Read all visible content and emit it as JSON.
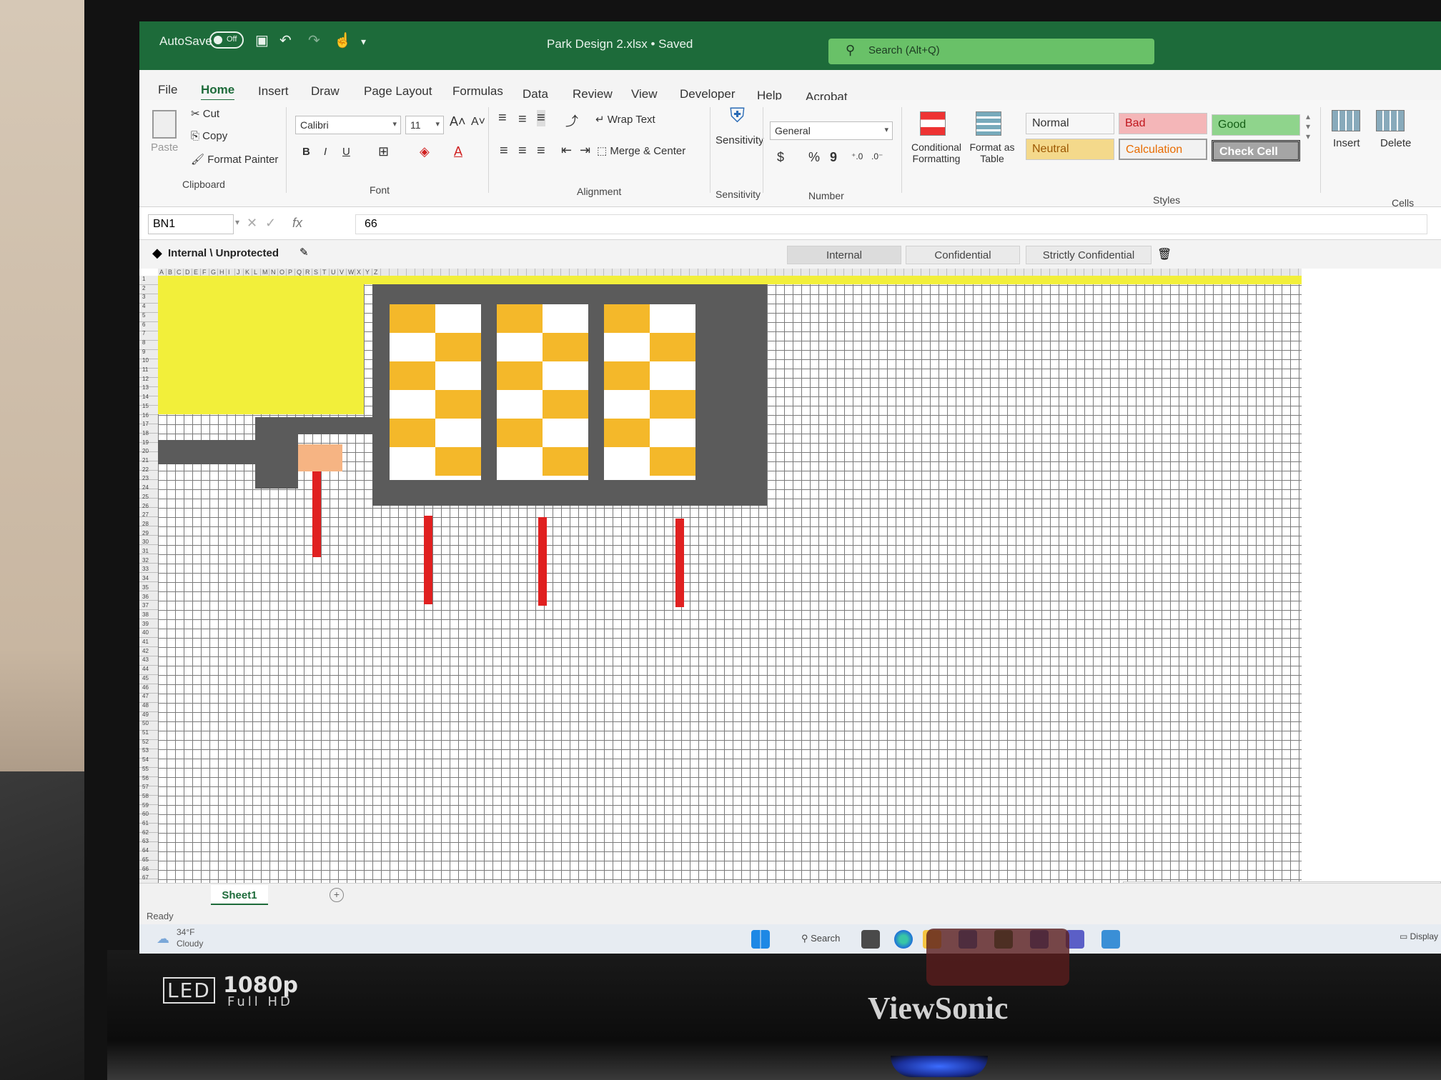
{
  "titlebar": {
    "autosave": "AutoSave",
    "autosave_state": "Off",
    "document": "Park Design 2.xlsx • Saved",
    "search": "Search (Alt+Q)"
  },
  "tabs": [
    "File",
    "Home",
    "Insert",
    "Draw",
    "Page Layout",
    "Formulas",
    "Data",
    "Review",
    "View",
    "Developer",
    "Help",
    "Acrobat"
  ],
  "ribbon": {
    "clipboard": {
      "paste": "Paste",
      "cut": "Cut",
      "copy": "Copy",
      "format_painter": "Format Painter",
      "label": "Clipboard"
    },
    "font": {
      "name": "Calibri",
      "size": "11",
      "bold": "B",
      "italic": "I",
      "underline": "U",
      "label": "Font"
    },
    "alignment": {
      "wrap_text": "Wrap Text",
      "merge_center": "Merge & Center",
      "label": "Alignment"
    },
    "sensitivity": {
      "button": "Sensitivity",
      "label": "Sensitivity"
    },
    "number": {
      "format": "General",
      "currency": "$",
      "percent": "%",
      "comma": "9",
      "label": "Number"
    },
    "styles": {
      "conditional": "Conditional Formatting",
      "format_table": "Format as Table",
      "label": "Styles",
      "cells": [
        {
          "name": "Normal",
          "bg": "#ffffff",
          "fg": "#000000"
        },
        {
          "name": "Bad",
          "bg": "#ffc7ce",
          "fg": "#9c0006"
        },
        {
          "name": "Good",
          "bg": "#c6efce",
          "fg": "#006100"
        },
        {
          "name": "Neutral",
          "bg": "#ffeb9c",
          "fg": "#9c5700"
        },
        {
          "name": "Calculation",
          "bg": "#f2f2f2",
          "fg": "#fa7d00"
        },
        {
          "name": "Check Cell",
          "bg": "#a5a5a5",
          "fg": "#ffffff"
        }
      ]
    },
    "cells": {
      "insert": "Insert",
      "delete": "Delete",
      "label": "Cells"
    }
  },
  "formula_bar": {
    "name_box": "BN1",
    "fx": "fx",
    "value": "66"
  },
  "sensitivity_bar": {
    "label": "Internal \\ Unprotected",
    "options": [
      "Internal",
      "Confidential",
      "Strictly Confidential"
    ]
  },
  "row_numbers": [
    "1",
    "2",
    "3",
    "4",
    "5",
    "6",
    "7",
    "8",
    "9",
    "10",
    "11",
    "12",
    "13",
    "14",
    "15",
    "16",
    "17",
    "18",
    "19",
    "20",
    "21",
    "22",
    "23",
    "24",
    "25",
    "26",
    "27",
    "28",
    "29",
    "30",
    "31",
    "32",
    "33",
    "34",
    "35",
    "36",
    "37",
    "38",
    "39",
    "40",
    "41",
    "42",
    "43",
    "44",
    "45",
    "46",
    "47",
    "48",
    "49",
    "50",
    "51",
    "52",
    "53",
    "54",
    "55",
    "56",
    "57",
    "58",
    "59",
    "60",
    "61",
    "62",
    "63",
    "64",
    "65",
    "66",
    "67"
  ],
  "column_letters": [
    "A",
    "B",
    "C",
    "D",
    "E",
    "F",
    "G",
    "H",
    "I",
    "J",
    "K",
    "L",
    "M",
    "N",
    "O",
    "P",
    "Q",
    "R",
    "S",
    "T",
    "U",
    "V",
    "W",
    "X",
    "Y",
    "Z"
  ],
  "colors": {
    "accent": "#1d6b3a",
    "yellow": "#f2ef3a",
    "dark": "#555555",
    "gold": "#f4b82a",
    "red": "#e02020",
    "peach": "#f6b483"
  },
  "sheet_tab": "Sheet1",
  "status": "Ready",
  "taskbar": {
    "weather_temp": "34°F",
    "weather_desc": "Cloudy",
    "search": "Search",
    "display": "Display"
  },
  "monitor": {
    "led": "LED",
    "resolution": "1080p",
    "resolution_sub": "Full HD",
    "brand": "ViewSonic"
  }
}
